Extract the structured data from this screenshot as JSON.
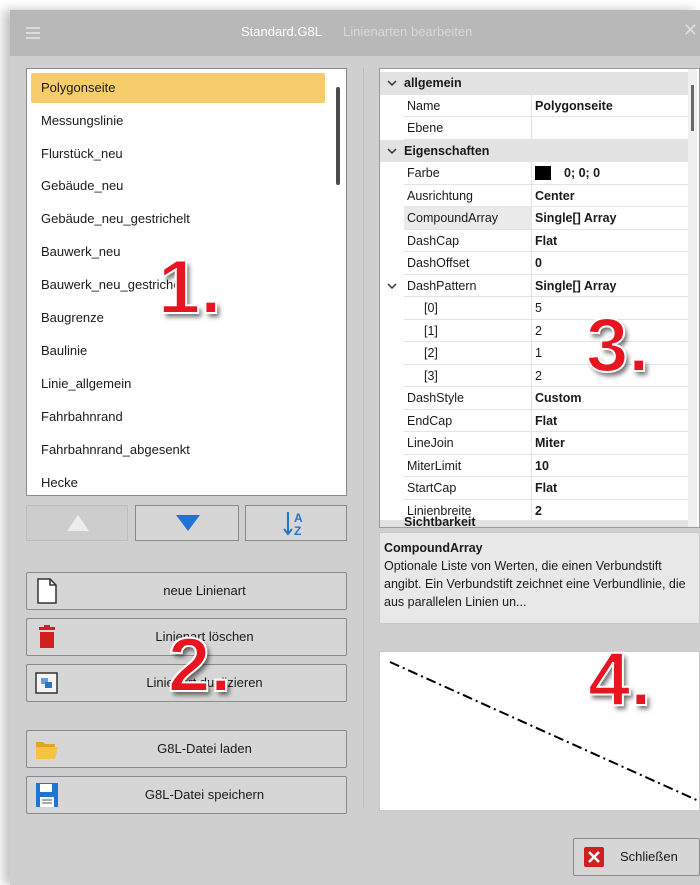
{
  "window": {
    "title": "Standard.G8L",
    "subtitle": "Linienarten bearbeiten",
    "close_glyph": "✕"
  },
  "line_types": {
    "selected": "Polygonseite",
    "items": [
      "Polygonseite",
      "Messungslinie",
      "Flurstück_neu",
      "Gebäude_neu",
      "Gebäude_neu_gestrichelt",
      "Bauwerk_neu",
      "Bauwerk_neu_gestrichelt",
      "Baugrenze",
      "Baulinie",
      "Linie_allgemein",
      "Fahrbahnrand",
      "Fahrbahnrand_abgesenkt",
      "Hecke"
    ]
  },
  "order_buttons": {
    "up_icon": "arrow-up-icon",
    "down_icon": "arrow-down-icon",
    "sort_icon": "sort-az-icon"
  },
  "actions": {
    "new": "neue Linienart",
    "delete": "Linienart löschen",
    "duplicate": "Linienart duplizieren",
    "load": "G8L-Datei laden",
    "save": "G8L-Datei speichern"
  },
  "properties": {
    "categories": {
      "general": "allgemein",
      "properties": "Eigenschaften",
      "cut_off": "Sichtbarkeit"
    },
    "rows": {
      "name": {
        "label": "Name",
        "value": "Polygonseite"
      },
      "layer": {
        "label": "Ebene",
        "value": ""
      },
      "color": {
        "label": "Farbe",
        "value": "0; 0; 0",
        "swatch": "#000000"
      },
      "alignment": {
        "label": "Ausrichtung",
        "value": "Center"
      },
      "compound_array": {
        "label": "CompoundArray",
        "value": "Single[] Array"
      },
      "dash_cap": {
        "label": "DashCap",
        "value": "Flat"
      },
      "dash_offset": {
        "label": "DashOffset",
        "value": "0"
      },
      "dash_pattern": {
        "label": "DashPattern",
        "value": "Single[] Array"
      },
      "dp0": {
        "label": "[0]",
        "value": "5"
      },
      "dp1": {
        "label": "[1]",
        "value": "2"
      },
      "dp2": {
        "label": "[2]",
        "value": "1"
      },
      "dp3": {
        "label": "[3]",
        "value": "2"
      },
      "dash_style": {
        "label": "DashStyle",
        "value": "Custom"
      },
      "end_cap": {
        "label": "EndCap",
        "value": "Flat"
      },
      "line_join": {
        "label": "LineJoin",
        "value": "Miter"
      },
      "miter_limit": {
        "label": "MiterLimit",
        "value": "10"
      },
      "start_cap": {
        "label": "StartCap",
        "value": "Flat"
      },
      "line_width": {
        "label": "Linienbreite",
        "value": "2"
      }
    }
  },
  "description": {
    "title": "CompoundArray",
    "text": "Optionale Liste von Werten, die einen Verbundstift angibt. Ein Verbundstift zeichnet eine Verbundlinie, die aus parallelen Linien un..."
  },
  "close_button": {
    "label": "Schließen"
  },
  "callouts": {
    "one": "1.",
    "two": "2.",
    "three": "3.",
    "four": "4."
  },
  "colors": {
    "selection": "#f7cd6b",
    "accent_blue": "#1f74d4",
    "delete_red": "#d11f1f",
    "callout_red": "#e8141f"
  }
}
